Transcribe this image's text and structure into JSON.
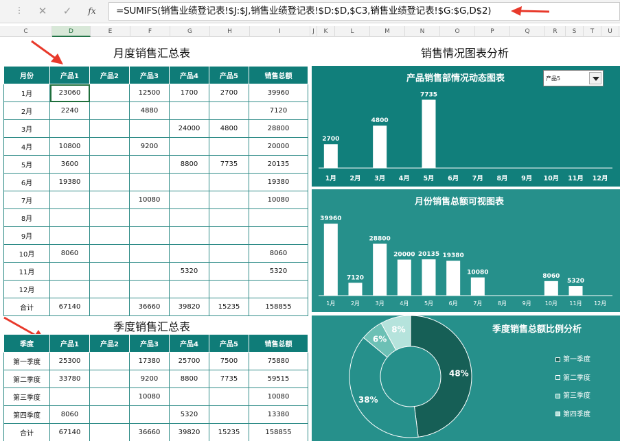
{
  "formula_bar": {
    "dots": "⋮",
    "cancel_icon": "✕",
    "enter_icon": "✓",
    "fx_label": "fx",
    "formula": "=SUMIFS(销售业绩登记表!$J:$J,销售业绩登记表!$D:$D,$C3,销售业绩登记表!$G:$G,D$2)"
  },
  "columns": [
    {
      "label": "C",
      "w": 76
    },
    {
      "label": "D",
      "w": 56
    },
    {
      "label": "E",
      "w": 58
    },
    {
      "label": "F",
      "w": 58
    },
    {
      "label": "G",
      "w": 58
    },
    {
      "label": "H",
      "w": 58
    },
    {
      "label": "I",
      "w": 88
    },
    {
      "label": "J",
      "w": 10
    },
    {
      "label": "K",
      "w": 26
    },
    {
      "label": "L",
      "w": 51
    },
    {
      "label": "M",
      "w": 51
    },
    {
      "label": "N",
      "w": 51
    },
    {
      "label": "O",
      "w": 51
    },
    {
      "label": "P",
      "w": 51
    },
    {
      "label": "Q",
      "w": 51
    },
    {
      "label": "R",
      "w": 30
    },
    {
      "label": "S",
      "w": 26
    },
    {
      "label": "T",
      "w": 26
    },
    {
      "label": "U",
      "w": 26
    }
  ],
  "titles": {
    "monthly": "月度销售汇总表",
    "quarterly": "季度销售汇总表",
    "analysis": "销售情况图表分析"
  },
  "monthly_table": {
    "headers": [
      "月份",
      "产品1",
      "产品2",
      "产品3",
      "产品4",
      "产品5",
      "销售总额"
    ],
    "rows": [
      [
        "1月",
        "23060",
        "",
        "12500",
        "1700",
        "2700",
        "39960"
      ],
      [
        "2月",
        "2240",
        "",
        "4880",
        "",
        "",
        "7120"
      ],
      [
        "3月",
        "",
        "",
        "",
        "24000",
        "4800",
        "28800"
      ],
      [
        "4月",
        "10800",
        "",
        "9200",
        "",
        "",
        "20000"
      ],
      [
        "5月",
        "3600",
        "",
        "",
        "8800",
        "7735",
        "20135"
      ],
      [
        "6月",
        "19380",
        "",
        "",
        "",
        "",
        "19380"
      ],
      [
        "7月",
        "",
        "",
        "10080",
        "",
        "",
        "10080"
      ],
      [
        "8月",
        "",
        "",
        "",
        "",
        "",
        ""
      ],
      [
        "9月",
        "",
        "",
        "",
        "",
        "",
        ""
      ],
      [
        "10月",
        "8060",
        "",
        "",
        "",
        "",
        "8060"
      ],
      [
        "11月",
        "",
        "",
        "",
        "5320",
        "",
        "5320"
      ],
      [
        "12月",
        "",
        "",
        "",
        "",
        "",
        ""
      ],
      [
        "合计",
        "67140",
        "",
        "36660",
        "39820",
        "15235",
        "158855"
      ]
    ]
  },
  "quarter_table": {
    "headers": [
      "季度",
      "产品1",
      "产品2",
      "产品3",
      "产品4",
      "产品5",
      "销售总额"
    ],
    "rows": [
      [
        "第一季度",
        "25300",
        "",
        "17380",
        "25700",
        "7500",
        "75880"
      ],
      [
        "第二季度",
        "33780",
        "",
        "9200",
        "8800",
        "7735",
        "59515"
      ],
      [
        "第三季度",
        "",
        "",
        "10080",
        "",
        "",
        "10080"
      ],
      [
        "第四季度",
        "8060",
        "",
        "",
        "5320",
        "",
        "13380"
      ],
      [
        "合计",
        "67140",
        "",
        "36660",
        "39820",
        "15235",
        "158855"
      ]
    ]
  },
  "dropdown": {
    "selected": "产品5"
  },
  "chart_data": [
    {
      "type": "bar",
      "title": "产品销售部情况动态图表",
      "categories": [
        "1月",
        "2月",
        "3月",
        "4月",
        "5月",
        "6月",
        "7月",
        "8月",
        "9月",
        "10月",
        "11月",
        "12月"
      ],
      "values": [
        2700,
        null,
        4800,
        null,
        7735,
        null,
        null,
        null,
        null,
        null,
        null,
        null
      ],
      "ylim": [
        0,
        8000
      ],
      "color": "#ffffff",
      "background": "#117f7b"
    },
    {
      "type": "bar",
      "title": "月份销售总额可视图表",
      "categories": [
        "1月",
        "2月",
        "3月",
        "4月",
        "5月",
        "6月",
        "7月",
        "8月",
        "9月",
        "10月",
        "11月",
        "12月"
      ],
      "values": [
        39960,
        7120,
        28800,
        20000,
        20135,
        19380,
        10080,
        null,
        null,
        8060,
        5320,
        null
      ],
      "ylim": [
        0,
        40000
      ],
      "color": "#ffffff",
      "background": "#26908b"
    },
    {
      "type": "pie",
      "donut": true,
      "title": "季度销售总额比例分析",
      "categories": [
        "第一季度",
        "第二季度",
        "第三季度",
        "第四季度"
      ],
      "values": [
        48,
        38,
        6,
        8
      ],
      "labels": [
        "48%",
        "38%",
        "6%",
        "8%"
      ],
      "colors": [
        "#165f56",
        "#26908b",
        "#6cc0b5",
        "#b5e3dc"
      ],
      "legend_position": "right"
    }
  ]
}
